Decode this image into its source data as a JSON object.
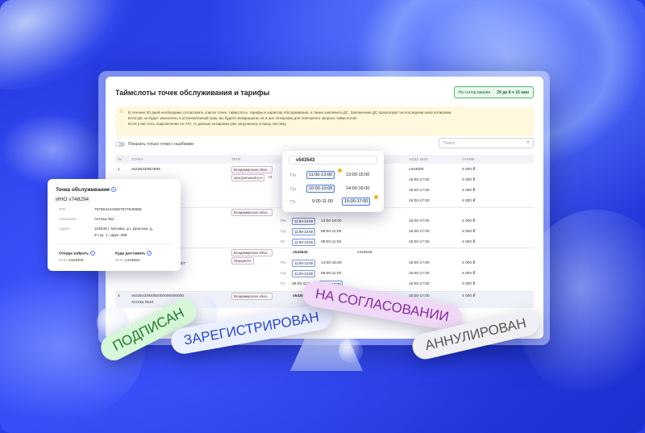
{
  "page": {
    "title": "Таймслоты точек обслуживания и тарифы",
    "status_label": "На согласовании",
    "status_time": "29 дн 8 ч 15 мин",
    "alert_lines": [
      "В течение 30 дней необходимо согласовать список точек, таймслоты, тарифы и характер обслуживания, а также заключить ДС. Заключение ДС происходит на последнем шаге котировки.",
      "Если ДС не будет заключено в установленный срок, вы будете возвращены на 3 шаг котировки для повторного запроса таймслотов.",
      "Если у вас есть подключение по API, то данные котировки уже загрузились в вашу систему."
    ],
    "toggle_label": "Показать только точки с ошибками",
    "search_placeholder": "Поиск"
  },
  "table": {
    "headers": [
      "№",
      "ТОЧКА",
      "ТЕГИ",
      "",
      "КУДА ИНО",
      "ТАРИФ"
    ],
    "rows": [
      {
        "num": "1",
        "point": "v543543/667898",
        "tags": [
          "Владимирская обла...",
          "Центральный р-н"
        ],
        "tag_more": "+2",
        "lines": [
          [
            "v444000",
            "4 000 ₽"
          ],
          [
            "15:00-17:00",
            "4 000 ₽"
          ],
          [
            "15:00-17:00",
            "4 000 ₽"
          ],
          [
            "15:00-17:00",
            "4 000 ₽"
          ]
        ]
      },
      {
        "tags": [
          "Владимирская обла..."
        ],
        "point_to": "v543543",
        "ino": "v444000",
        "lines": [
          [
            "Пн",
            "11:00-13:00",
            "13:00-15:00",
            "15:00-17:00",
            "4 000 ₽"
          ],
          [
            "Ср",
            "11:00-13:00",
            "09:00-11:00",
            "15:00-17:00",
            "4 000 ₽"
          ],
          [
            "Пт",
            "11:00-13:00",
            "09:00-11:00",
            "15:00-17:00",
            "4 000 ₽"
          ],
          [
            "Пт",
            "09:00-11:00",
            "15:00-17:00",
            "15:00-17:00",
            "4 000 ₽"
          ]
        ]
      },
      {
        "point_suffix": "33/7",
        "tags": [
          "Владимирская обла...",
          "Приоритет"
        ],
        "point_to": "v543543",
        "ino": "v444645",
        "lines": [
          [
            "Пн",
            "11:00-13:00",
            "13:00-15:00",
            "15:00-17:00",
            "4 000 ₽"
          ],
          [
            "Ср",
            "11:00-13:00",
            "09:00-11:00",
            "15:00-17:00",
            "4 000 ₽"
          ],
          [
            "Пт",
            "09:00-11:00",
            "15:00-17:00",
            "15:00-17:00",
            "4 000 ₽"
          ]
        ]
      },
      {
        "num": "4",
        "point": "v543543/00000000000000000",
        "point_name": "Аптека №10",
        "point_addr": "Москва, ул...",
        "tags": [
          "Владимирская обла..."
        ],
        "point_to": "v543543",
        "ino": "v444645",
        "lines": [
          [
            "15:00-17:00",
            "4 000 ₽"
          ]
        ]
      }
    ]
  },
  "point_card": {
    "title": "Точка обслуживания",
    "ino_label": "ИНО",
    "ino": "v748294",
    "pin_label": "PIN",
    "pin": "7576644444667677645555",
    "name_label": "Название",
    "name": "Аптека №1",
    "addr_label": "Адрес",
    "addr1": "119049 г. Москва, ул. Донская, д.",
    "addr2": "8 стр. 1, офис 306",
    "from_title": "Откуда забрать",
    "from_ino_label": "ИНО",
    "from_ino": "v444000",
    "to_title": "Куда доставить",
    "to_ino_label": "ИНО",
    "to_ino": "v444654"
  },
  "time_card": {
    "title": "v543543",
    "rows": [
      {
        "day": "Пн",
        "s1": "11:00-13:00",
        "s2": "13:00-15:00"
      },
      {
        "day": "Ср",
        "s1": "10:00-13:00",
        "s2": "14:00-16:00"
      },
      {
        "day": "Пт",
        "s1": "9:00-11:00",
        "s2": "15:00-17:00"
      }
    ]
  },
  "pills": {
    "signed": "ПОДПИСАН",
    "registered": "ЗАРЕГИСТРИРОВАН",
    "approval": "НА СОГЛАСОВАНИИ",
    "cancelled": "АННУЛИРОВАН"
  },
  "colors": {
    "background": "#2f49f2",
    "accent": "#4b7be3",
    "status_green": "#59b778",
    "alert": "#fff8de"
  }
}
